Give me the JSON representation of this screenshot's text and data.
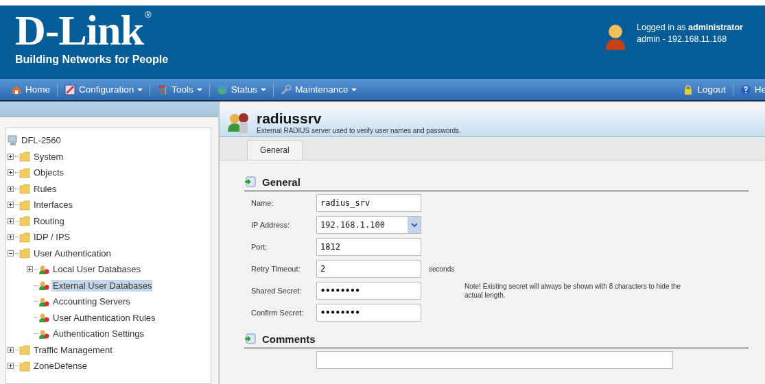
{
  "header": {
    "logo": "D-Link",
    "registered": "®",
    "tagline": "Building Networks for People",
    "user_line": "Logged in as **administrator**",
    "session": "admin - 192.168.11.168"
  },
  "nav": {
    "items": [
      {
        "label": "Home",
        "dropdown": false
      },
      {
        "label": "Configuration",
        "dropdown": true
      },
      {
        "label": "Tools",
        "dropdown": true
      },
      {
        "label": "Status",
        "dropdown": true
      },
      {
        "label": "Maintenance",
        "dropdown": true
      }
    ],
    "right": [
      {
        "label": "Logout"
      },
      {
        "label": "He"
      }
    ]
  },
  "tree": {
    "label": "DFL-2560",
    "children": [
      {
        "label": "System",
        "expanded": false,
        "selected": false
      },
      {
        "label": "Objects",
        "expanded": false,
        "selected": false
      },
      {
        "label": "Rules",
        "expanded": false,
        "selected": false
      },
      {
        "label": "Interfaces",
        "expanded": false,
        "selected": false
      },
      {
        "label": "Routing",
        "expanded": false,
        "selected": false
      },
      {
        "label": "IDP / IPS",
        "expanded": false,
        "selected": false
      },
      {
        "label": "User Authentication",
        "expanded": true,
        "selected": false,
        "children": [
          {
            "label": "Local User Databases",
            "expanded": false,
            "selected": false
          },
          {
            "label": "External User Databases",
            "selected": true
          },
          {
            "label": "Accounting Servers",
            "selected": false
          },
          {
            "label": "User Authentication Rules",
            "selected": false
          },
          {
            "label": "Authentication Settings",
            "selected": false
          }
        ]
      },
      {
        "label": "Traffic Management",
        "expanded": false,
        "selected": false
      },
      {
        "label": "ZoneDefense",
        "expanded": false,
        "selected": false
      }
    ]
  },
  "page": {
    "title": "radiussrv",
    "description": "External RADIUS server used to verify user names and passwords.",
    "tabs": [
      {
        "label": "General",
        "selected": true
      }
    ],
    "sections": [
      {
        "title": "General",
        "fields": [
          {
            "label": "Name:",
            "kind": "text",
            "value": "radius_srv"
          },
          {
            "label": "IP Address:",
            "kind": "select",
            "value": "192.168.1.100"
          },
          {
            "label": "Port:",
            "kind": "text",
            "value": "1812"
          },
          {
            "label": "Retry Timeout:",
            "kind": "text",
            "value": "2",
            "suffix": "seconds"
          },
          {
            "label": "Shared Secret:",
            "kind": "password",
            "value": "••••••••",
            "note": "Note! Existing secret will always be shown with 8 characters to hide the actual length."
          },
          {
            "label": "Confirm Secret:",
            "kind": "password",
            "value": "••••••••"
          }
        ]
      },
      {
        "title": "Comments",
        "fields": [
          {
            "kind": "textarea"
          }
        ]
      }
    ]
  }
}
